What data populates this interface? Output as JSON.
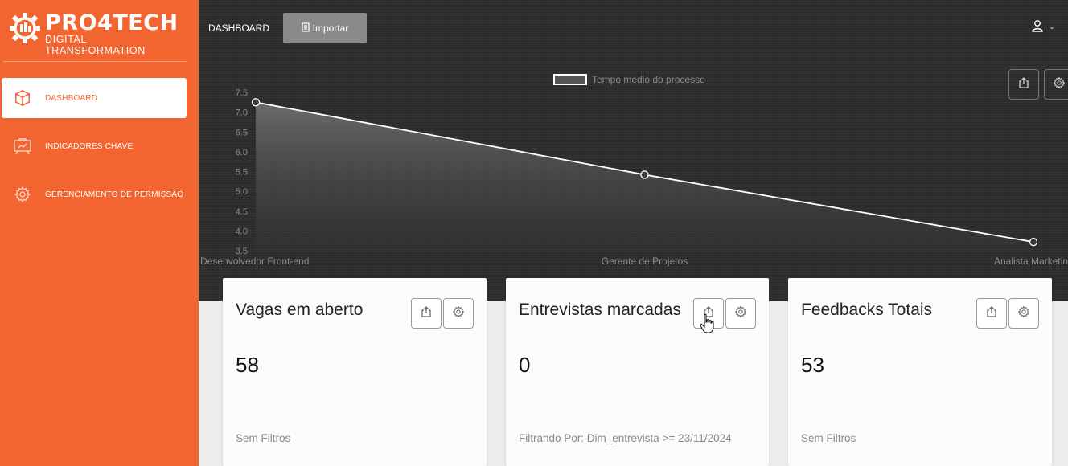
{
  "brand": {
    "title": "PRO4TECH",
    "subtitle": "DIGITAL TRANSFORMATION",
    "color": "#f26430"
  },
  "sidebar": {
    "items": [
      {
        "label": "DASHBOARD",
        "icon": "cube-icon",
        "active": true
      },
      {
        "label": "INDICADORES CHAVE",
        "icon": "presentation-board-icon",
        "active": false
      },
      {
        "label": "GERENCIAMENTO DE PERMISSÃO",
        "icon": "gear-icon",
        "active": false
      }
    ]
  },
  "topbar": {
    "dashboard_label": "DASHBOARD",
    "import_label": "Importar",
    "user_caret": "-"
  },
  "chart_data": {
    "type": "area",
    "categories": [
      "Desenvolvedor Front-end",
      "Gerente de Projetos",
      "Analista Marketing"
    ],
    "series": [
      {
        "name": "Tempo medio do processo",
        "values": [
          7.25,
          5.42,
          3.72
        ]
      }
    ],
    "ylim": [
      3.5,
      7.5
    ],
    "yticks": [
      "3.5",
      "4.0",
      "4.5",
      "5.0",
      "5.5",
      "6.0",
      "6.5",
      "7.0",
      "7.5"
    ],
    "legend": "top-center",
    "grid": false
  },
  "cards": [
    {
      "title": "Vagas em aberto",
      "value": "58",
      "filter": "Sem Filtros"
    },
    {
      "title": "Entrevistas marcadas",
      "value": "0",
      "filter": "Filtrando Por: Dim_entrevista >= 23/11/2024"
    },
    {
      "title": "Feedbacks Totais",
      "value": "53",
      "filter": "Sem Filtros"
    }
  ]
}
